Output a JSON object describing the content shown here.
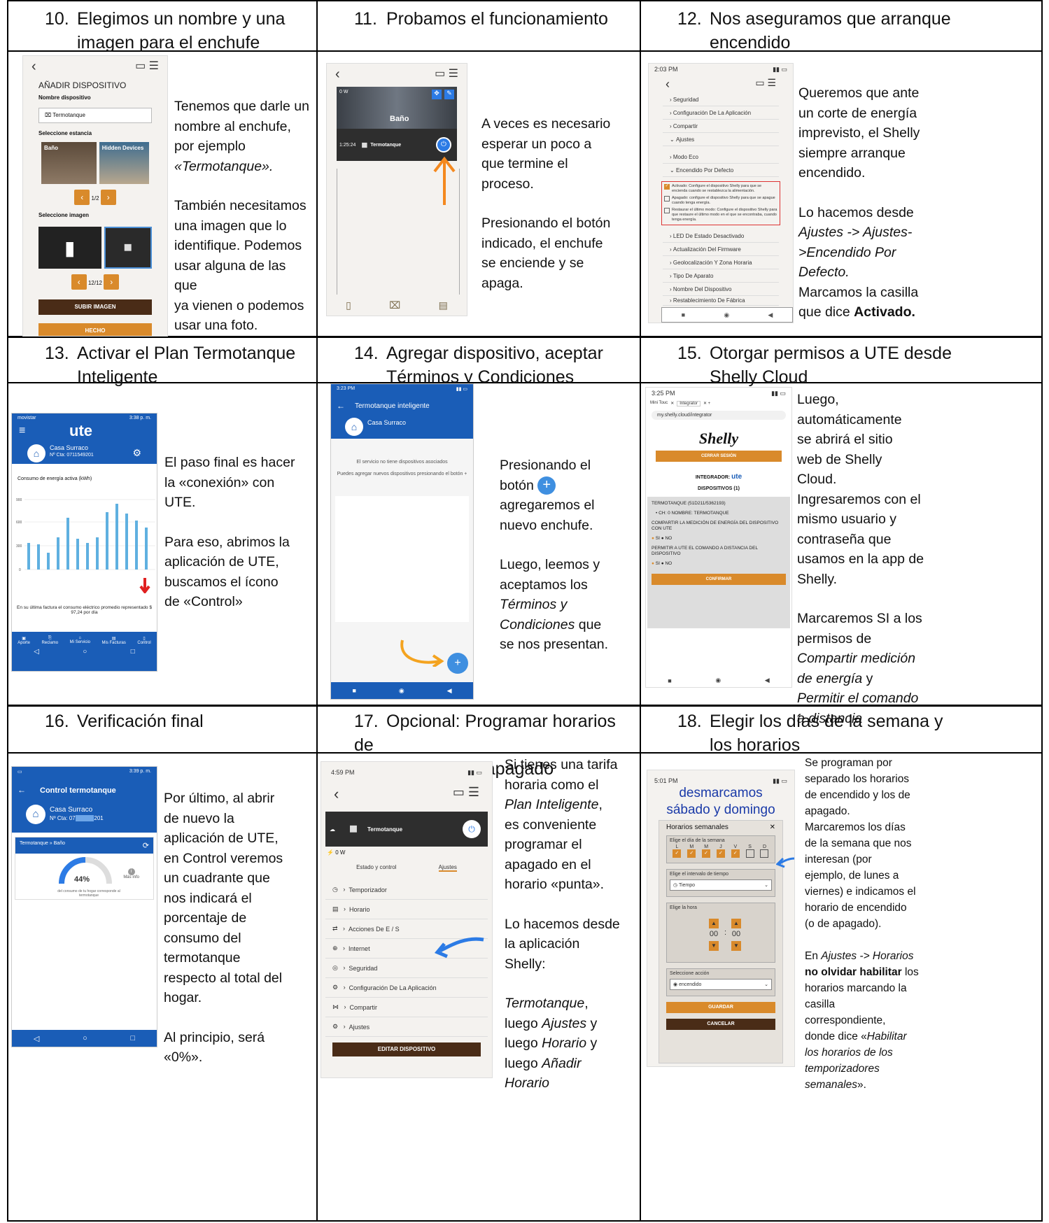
{
  "steps": [
    {
      "num": "10.",
      "title_l1": "Elegimos un nombre y una",
      "title_l2": "imagen para el enchufe"
    },
    {
      "num": "11.",
      "title_l1": "Probamos el funcionamiento",
      "title_l2": ""
    },
    {
      "num": "12.",
      "title_l1": "Nos aseguramos que arranque",
      "title_l2": "encendido"
    },
    {
      "num": "13.",
      "title_l1": "Activar el Plan Termotanque",
      "title_l2": "Inteligente"
    },
    {
      "num": "14.",
      "title_l1": "Agregar dispositivo, aceptar",
      "title_l2": "Términos y Condiciones"
    },
    {
      "num": "15.",
      "title_l1": "Otorgar permisos a UTE desde",
      "title_l2": "Shelly Cloud"
    },
    {
      "num": "16.",
      "title_l1": "Verificación final",
      "title_l2": ""
    },
    {
      "num": "17.",
      "title_l1": "Opcional: Programar horarios de",
      "title_l2": "encendido y apagado"
    },
    {
      "num": "18.",
      "title_l1": "Elegir los días de la semana y",
      "title_l2": "los horarios"
    }
  ],
  "text10": {
    "a": "Tenemos que darle un",
    "b": "nombre al enchufe,",
    "c": "por ejemplo",
    "d": "«Termotanque».",
    "e": "También necesitamos",
    "f": "una imagen que lo",
    "g": "identifique. Podemos",
    "h": "usar alguna de las que",
    "i": "ya vienen o podemos",
    "j": "usar una foto."
  },
  "text11": {
    "a": "A veces es necesario",
    "b": "esperar un poco a",
    "c": "que termine el",
    "d": "proceso.",
    "e": "Presionando el botón",
    "f": "indicado, el enchufe",
    "g": "se enciende y se",
    "h": "apaga."
  },
  "text12": {
    "a": "Queremos que ante",
    "b": "un corte de energía",
    "c": "imprevisto, el Shelly",
    "d": "siempre arranque",
    "e": "encendido.",
    "f": "Lo hacemos desde",
    "g": "Ajustes -> Ajustes-",
    "h": ">Encendido Por",
    "i": "Defecto.",
    "j": "Marcamos la casilla",
    "k": "que dice ",
    "l": "Activado."
  },
  "text13": {
    "a": "El paso final es hacer",
    "b": "la «conexión» con",
    "c": "UTE.",
    "d": "Para eso, abrimos la",
    "e": "aplicación de UTE,",
    "f": "buscamos el ícono",
    "g": "de «Control»"
  },
  "text14": {
    "a": "Presionando el",
    "b": "botón",
    "c": "agregaremos el",
    "d": "nuevo enchufe.",
    "e": "Luego, leemos y",
    "f": "aceptamos los",
    "g": "Términos y",
    "h": "Condiciones",
    "h2": " que",
    "i": "se nos presentan."
  },
  "text15": {
    "a": "Luego,",
    "b": "automáticamente",
    "c": "se abrirá el sitio",
    "d": "web de Shelly",
    "e": "Cloud.",
    "f": "Ingresaremos con el",
    "g": "mismo usuario y",
    "h": "contraseña que",
    "i": "usamos en la app de",
    "j": "Shelly.",
    "k": "Marcaremos SI a los",
    "l": "permisos de",
    "m": "Compartir medición",
    "n": "de energía",
    "n2": " y",
    "o": "Permitir el comando",
    "p": "a distancia"
  },
  "text16": {
    "a": "Por último, al abrir",
    "b": "de nuevo la",
    "c": "aplicación de UTE,",
    "d": "en Control veremos",
    "e": "un cuadrante que",
    "f": "nos indicará el",
    "g": "porcentaje de",
    "h": "consumo del",
    "i": "termotanque",
    "j": "respecto al total del",
    "k": "hogar.",
    "l": "Al principio, será",
    "m": "«0%»."
  },
  "text17": {
    "a": "Si tienes una tarifa",
    "b": "horaria como el",
    "c": "Plan Inteligente",
    "c2": ",",
    "d": "es conveniente",
    "e": "programar el",
    "f": "apagado en el",
    "g": "horario «punta».",
    "h": "Lo hacemos desde",
    "i": "la aplicación",
    "j": "Shelly:",
    "k": "Termotanque",
    "k2": ",",
    "l": "luego ",
    "l2": "Ajustes",
    "l3": " y",
    "m": "luego ",
    "m2": "Horario",
    "m3": " y",
    "n": "luego ",
    "n2": "Añadir",
    "o": "Horario"
  },
  "text18": {
    "a": "Se programan por",
    "b": "separado los horarios",
    "c": "de encendido y los de",
    "d": "apagado.",
    "e": "Marcaremos los días",
    "f": "de la semana que nos",
    "g": "interesan (por",
    "h": "ejemplo, de lunes a",
    "i": "viernes) e indicamos el",
    "j": "horario de encendido",
    "k": "(o de apagado).",
    "l": "En ",
    "l2": "Ajustes -> Horarios",
    "m": "no olvidar habilitar",
    "m2": " los",
    "n": "horarios marcando la",
    "o": "casilla",
    "p": "correspondiente,",
    "q": "donde dice «",
    "q2": "Habilitar",
    "r": "los horarios de los",
    "s": "temporizadores",
    "t": "semanales",
    "t2": "»."
  },
  "shot10": {
    "title": "AÑADIR DISPOSITIVO",
    "name_label": "Nombre dispositivo",
    "name_value": "Termotanque",
    "room_label": "Seleccione estancia",
    "room1": "Baño",
    "room2": "Hidden Devices",
    "pager1": "1/2",
    "image_label": "Seleccione imagen",
    "pager2": "12/12",
    "upload": "SUBIR IMAGEN",
    "done": "HECHO"
  },
  "shot11": {
    "power": "0 W",
    "room": "Baño",
    "device": "Termotanque",
    "dev_power": "0 W",
    "time": "1:25:24"
  },
  "shot12": {
    "status": "2:03 PM",
    "items": [
      "Seguridad",
      "Configuración De La Aplicación",
      "Compartir",
      "Ajustes"
    ],
    "items2": [
      "Modo Eco",
      "Encendido Por Defecto"
    ],
    "opt1": "Activado: Configure el dispositivo Shelly para que se encienda cuando se restablezca la alimentación.",
    "opt2": "Apagado: configure el dispositivo Shelly para que se apague cuando tenga energía.",
    "opt3": "Restaurar el último modo: Configure el dispositivo Shelly para que restaure el último modo en el que se encontraba, cuando tenga energía.",
    "items3": [
      "LED De Estado Desactivado",
      "Actualización Del Firmware",
      "Geolocalización Y Zona Horaria",
      "Tipo De Aparato",
      "Nombre Del Dispositivo",
      "Restablecimiento De Fábrica"
    ]
  },
  "shot13": {
    "carrier": "movistar",
    "time": "3:38 p. m.",
    "logo": "ute",
    "home": "Casa Surraco",
    "account": "Nº Cta: 0711549201",
    "chart_title": "Consumo de energía activa (kWh)",
    "footer": "En su última factura el consumo eléctrico promedio representado $ 97,24 por día",
    "tabs": [
      "Aporte",
      "Reclamo",
      "Mi Servicio",
      "Mis Facturas",
      "Control"
    ]
  },
  "shot14": {
    "time": "3:23 PM",
    "title": "Termotanque inteligente",
    "home": "Casa Surraco",
    "msg1": "El servicio no tiene dispositivos asociados",
    "msg2": "Puedes agregar nuevos dispositivos presionando el botón +"
  },
  "shot15": {
    "time": "3:25 PM",
    "tab1": "Mini Touc",
    "tab2": "Integrator",
    "url": "my.shelly.cloud/integrator",
    "logo": "Shelly",
    "logout": "CERRAR SESIÓN",
    "integrator": "INTEGRADOR:",
    "ute": "ute",
    "devices": "DISPOSITIVOS (1)",
    "dev": "TERMOTANQUE (51D211/5362193)",
    "ch": "• CH: 0 NOMBRE: TERMOTANQUE",
    "q1": "COMPARTIR LA MEDICIÓN DE ENERGÍA DEL DISPOSITIVO CON UTE",
    "q2": "PERMITIR A UTE EL COMANDO A DISTANCIA DEL DISPOSITIVO",
    "si": "SI",
    "no": "NO",
    "confirm": "CONFIRMAR"
  },
  "shot16": {
    "time": "3:39 p. m.",
    "title": "Control termotanque",
    "home": "Casa Surraco",
    "account": "Nº Cta: 07",
    "account2": "201",
    "crumb": "Termotanque » Baño",
    "percent": "44%",
    "more": "Más info",
    "note": "del consumo de tu hogar corresponde al termotanque"
  },
  "shot17": {
    "time": "4:59 PM",
    "device": "Termotanque",
    "power": "0 W",
    "tab1": "Estado y control",
    "tab2": "Ajustes",
    "items": [
      "Temporizador",
      "Horario",
      "Acciones De E / S",
      "Internet",
      "Seguridad",
      "Configuración De La Aplicación",
      "Compartir",
      "Ajustes"
    ],
    "edit": "EDITAR DISPOSITIVO"
  },
  "shot18": {
    "time": "5:01 PM",
    "overlay1": "desmarcamos",
    "overlay2": "sábado y domingo",
    "dialog": "Horarios semanales",
    "days_label": "Elige el día de la semana",
    "days": [
      "L",
      "M",
      "M",
      "J",
      "V",
      "S",
      "D"
    ],
    "interval_label": "Elige el intervalo de tiempo",
    "interval": "Tiempo",
    "hour_label": "Elige la hora",
    "hour": "00",
    "minute": "00",
    "action_label": "Seleccione acción",
    "action": "encendido",
    "save": "GUARDAR",
    "cancel": "CANCELAR"
  },
  "colors": {
    "ute_blue": "#1a5db7",
    "shelly_orange": "#d98a2b",
    "shelly_brown": "#4a2c17",
    "arrow_red": "#e02020"
  }
}
